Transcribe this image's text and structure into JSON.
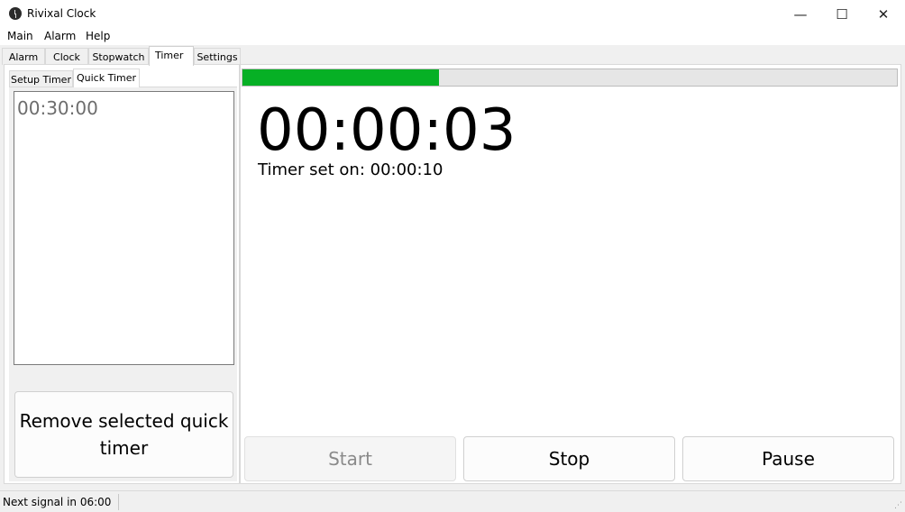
{
  "window": {
    "title": "Rivixal Clock",
    "minimize": "—",
    "maximize": "☐",
    "close": "✕"
  },
  "menu": [
    "Main",
    "Alarm",
    "Help"
  ],
  "tabs": [
    "Alarm",
    "Clock",
    "Stopwatch",
    "Timer",
    "Settings"
  ],
  "active_tab": "Timer",
  "subtabs": [
    "Setup Timer",
    "Quick Timer"
  ],
  "active_subtab": "Quick Timer",
  "quick_timers": [
    "00:30:00"
  ],
  "remove_button": "Remove selected quick timer",
  "progress": {
    "fraction": 0.3,
    "color": "#06b025"
  },
  "timer": {
    "display": "00:00:03",
    "set_on": "Timer set on: 00:00:10"
  },
  "buttons": {
    "start": "Start",
    "stop": "Stop",
    "pause": "Pause"
  },
  "status": {
    "text": "Next signal in 06:00"
  }
}
